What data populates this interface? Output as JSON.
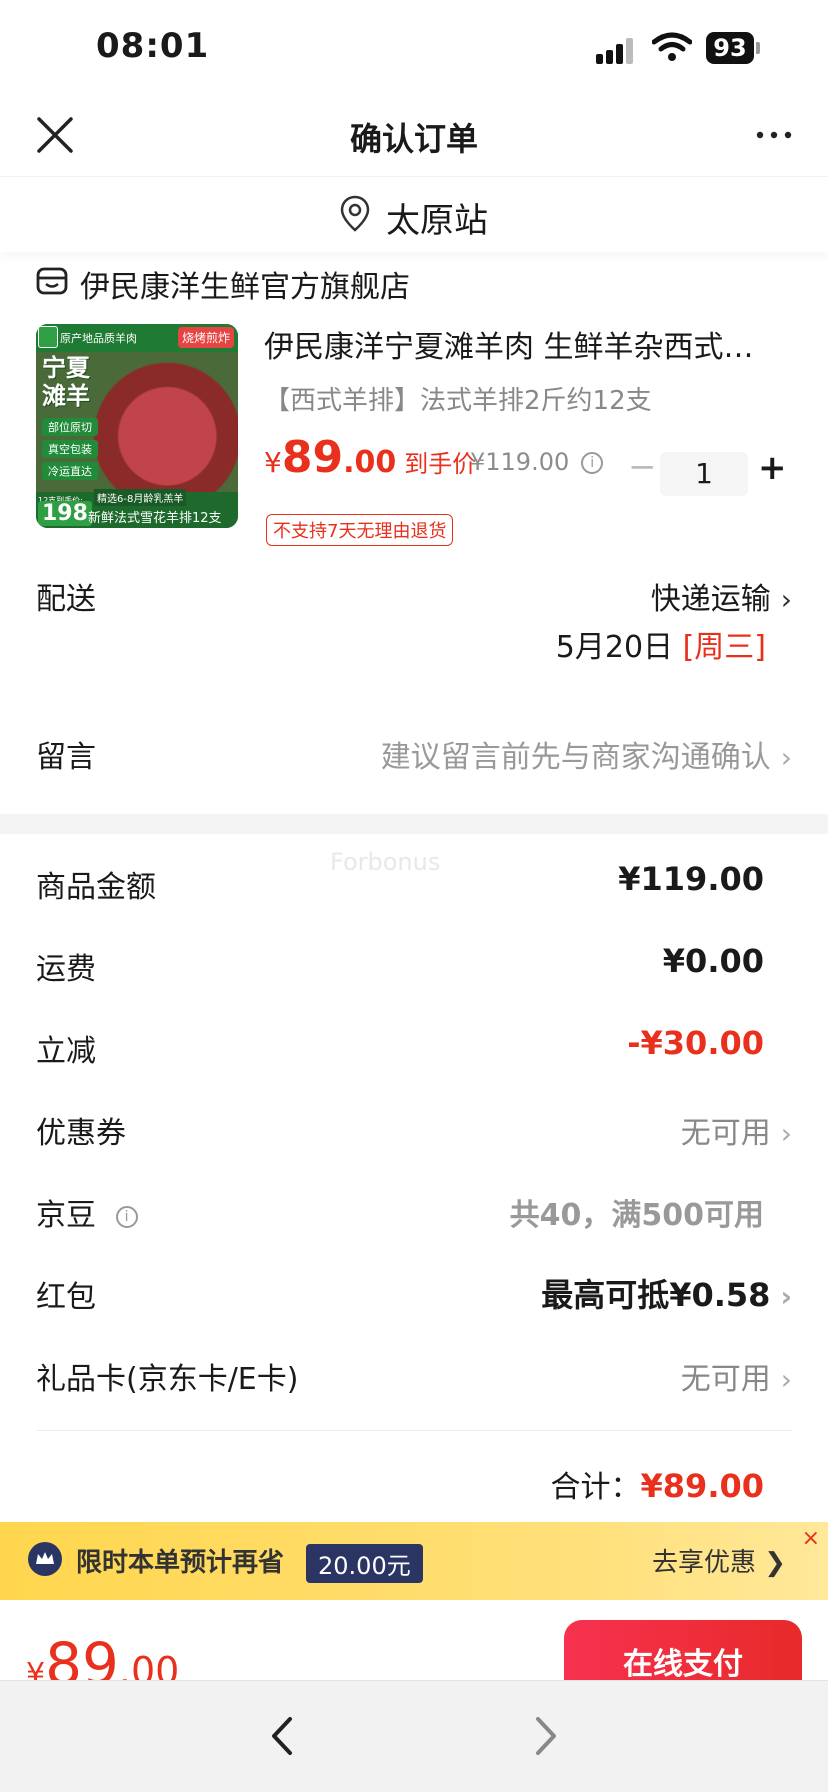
{
  "status_bar": {
    "time": "08:01",
    "battery": "93"
  },
  "header": {
    "title": "确认订单"
  },
  "address": {
    "name": "太原站"
  },
  "shop": {
    "name": "伊民康洋生鲜官方旗舰店"
  },
  "product": {
    "title": "伊民康洋宁夏滩羊肉 生鲜羊杂西式…",
    "spec": "【西式羊排】法式羊排2斤约12支",
    "price_currency": "¥",
    "price_int": "89",
    "price_dec": ".00",
    "price_label": "到手价",
    "original_price": "¥119.00",
    "quantity": "1",
    "minus": "−",
    "plus": "+",
    "return_tag": "不支持7天无理由退货",
    "image": {
      "origin": "原产地品质羊肉",
      "bbq": "烧烤煎炸",
      "big_text": "宁夏滩羊",
      "chips": [
        "部位原切",
        "真空包装",
        "冷运直达"
      ],
      "price_label": "12支到手价:",
      "price": "198",
      "selected": "精选6-8月龄乳羔羊",
      "desc": "新鲜法式雪花羊排12支"
    }
  },
  "delivery": {
    "label": "配送",
    "method": "快递运输",
    "date": "5月20日",
    "weekday": "[周三]"
  },
  "message": {
    "label": "留言",
    "hint": "建议留言前先与商家沟通确认"
  },
  "watermark": "Forbonus",
  "summary": {
    "goods_label": "商品金额",
    "goods_value": "¥119.00",
    "freight_label": "运费",
    "freight_value": "¥0.00",
    "discount_label": "立减",
    "discount_value": "-¥30.00",
    "coupon_label": "优惠券",
    "coupon_value": "无可用",
    "jingdou_label": "京豆",
    "jingdou_value": "共40，满500可用",
    "redpack_label": "红包",
    "redpack_value": "最高可抵¥0.58",
    "giftcard_label": "礼品卡(京东卡/E卡)",
    "giftcard_value": "无可用",
    "total_label": "合计：",
    "total_value": "¥89.00"
  },
  "promo": {
    "text": "限时本单预计再省",
    "amount": "20.00元",
    "action": "去享优惠 ❯",
    "close": "×"
  },
  "bottom": {
    "currency": "¥",
    "int": "89",
    "dec": ".00",
    "pay_label": "在线支付"
  },
  "colors": {
    "accent": "#e8301c",
    "promo_bg": "#ffd64d",
    "badge_navy": "#2a3563"
  }
}
